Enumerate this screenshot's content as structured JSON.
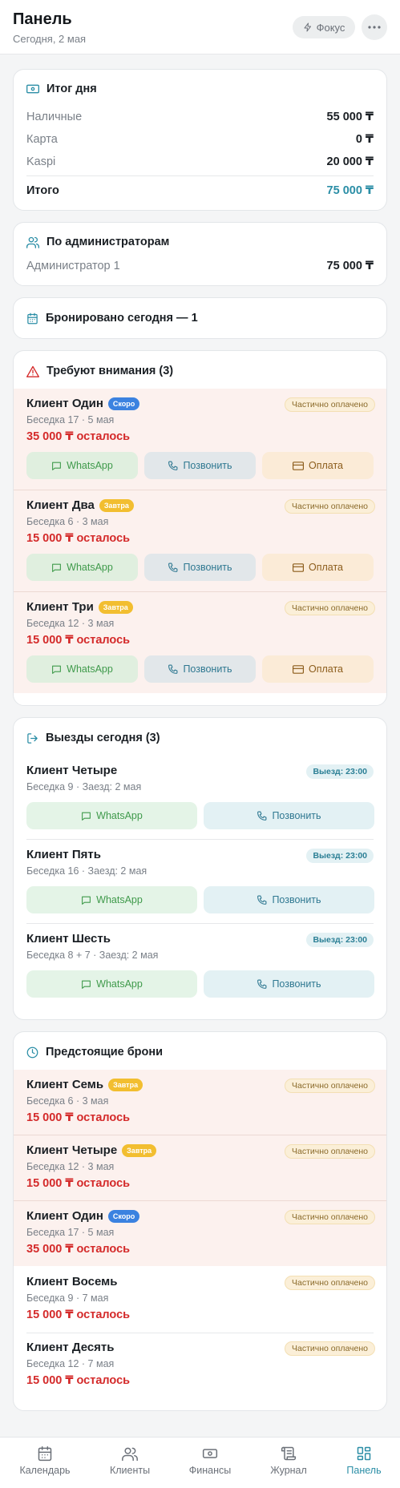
{
  "header": {
    "title": "Панель",
    "subtitle": "Сегодня, 2 мая",
    "focus_label": "Фокус"
  },
  "summary": {
    "title": "Итог дня",
    "rows": [
      {
        "label": "Наличные",
        "value": "55 000 ₸"
      },
      {
        "label": "Карта",
        "value": "0 ₸"
      },
      {
        "label": "Kaspi",
        "value": "20 000 ₸"
      }
    ],
    "total_label": "Итого",
    "total_value": "75 000 ₸"
  },
  "admins": {
    "title": "По администраторам",
    "rows": [
      {
        "label": "Администратор 1",
        "value": "75 000 ₸"
      }
    ]
  },
  "booked": {
    "title": "Бронировано сегодня — 1"
  },
  "attention": {
    "title": "Требуют внимания (3)",
    "items": [
      {
        "name": "Клиент Один",
        "badge": "Скоро",
        "status": "Частично оплачено",
        "details": "Беседка 17 · 5 мая",
        "remaining": "35 000 ₸ осталось"
      },
      {
        "name": "Клиент Два",
        "badge": "Завтра",
        "status": "Частично оплачено",
        "details": "Беседка 6 · 3 мая",
        "remaining": "15 000 ₸ осталось"
      },
      {
        "name": "Клиент Три",
        "badge": "Завтра",
        "status": "Частично оплачено",
        "details": "Беседка 12 · 3 мая",
        "remaining": "15 000 ₸ осталось"
      }
    ],
    "whatsapp_label": "WhatsApp",
    "call_label": "Позвонить",
    "pay_label": "Оплата"
  },
  "departures": {
    "title": "Выезды сегодня (3)",
    "items": [
      {
        "name": "Клиент Четыре",
        "badge": "Выезд: 23:00",
        "details": "Беседка 9 · Заезд: 2 мая"
      },
      {
        "name": "Клиент Пять",
        "badge": "Выезд: 23:00",
        "details": "Беседка 16 · Заезд: 2 мая"
      },
      {
        "name": "Клиент Шесть",
        "badge": "Выезд: 23:00",
        "details": "Беседка 8 + 7 · Заезд: 2 мая"
      }
    ],
    "whatsapp_label": "WhatsApp",
    "call_label": "Позвонить"
  },
  "upcoming": {
    "title": "Предстоящие брони",
    "items": [
      {
        "name": "Клиент Семь",
        "badge": "Завтра",
        "status": "Частично оплачено",
        "details": "Беседка 6 · 3 мая",
        "remaining": "15 000 ₸ осталось"
      },
      {
        "name": "Клиент Четыре",
        "badge": "Завтра",
        "status": "Частично оплачено",
        "details": "Беседка 12 · 3 мая",
        "remaining": "15 000 ₸ осталось"
      },
      {
        "name": "Клиент Один",
        "badge": "Скоро",
        "status": "Частично оплачено",
        "details": "Беседка 17 · 5 мая",
        "remaining": "35 000 ₸ осталось"
      },
      {
        "name": "Клиент Восемь",
        "badge": "",
        "status": "Частично оплачено",
        "details": "Беседка 9 · 7 мая",
        "remaining": "15 000 ₸ осталось"
      },
      {
        "name": "Клиент Десять",
        "badge": "",
        "status": "Частично оплачено",
        "details": "Беседка 12 · 7 мая",
        "remaining": "15 000 ₸ осталось"
      }
    ]
  },
  "nav": {
    "items": [
      {
        "label": "Календарь",
        "icon": "calendar-icon"
      },
      {
        "label": "Клиенты",
        "icon": "users-icon"
      },
      {
        "label": "Финансы",
        "icon": "banknote-icon"
      },
      {
        "label": "Журнал",
        "icon": "scroll-icon"
      },
      {
        "label": "Панель",
        "icon": "dashboard-icon"
      }
    ],
    "active": "Панель"
  },
  "colors": {
    "accent": "#2b8ea6",
    "danger": "#d42a2a",
    "soon_badge": "#3b82e0",
    "tomorrow_badge": "#f2be30",
    "attention_bg": "#fcf1ee"
  }
}
